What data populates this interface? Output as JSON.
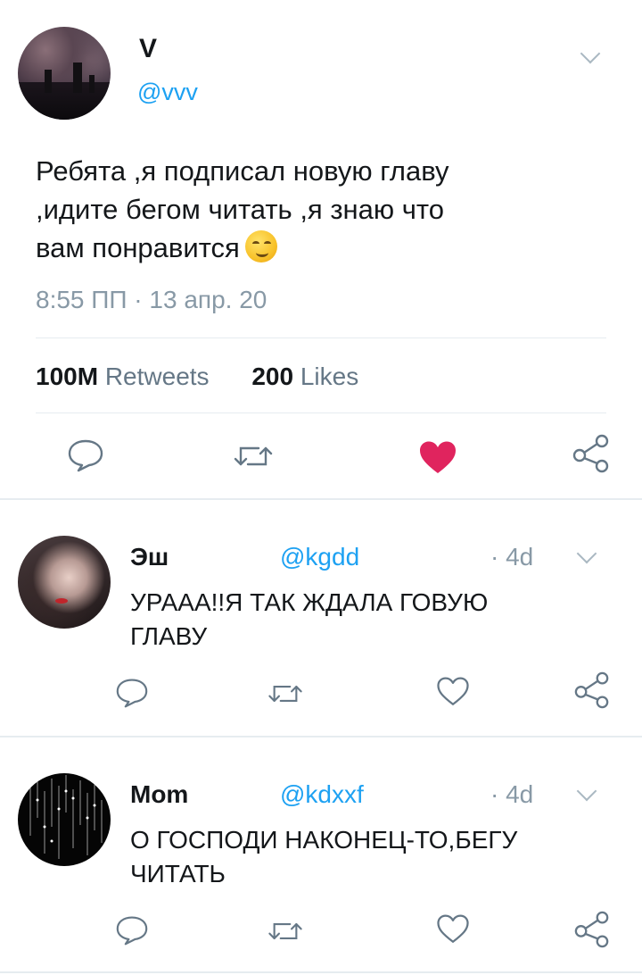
{
  "tweet": {
    "name": "V",
    "handle": "@vvv",
    "text": "Ребята ,я подписал новую главу ,идите бегом читать ,я знаю что вам понравится",
    "emoji": "smirking-face",
    "time": "8:55 ПП · 13 апр. 20",
    "retweets_count": "100M",
    "retweets_label": "Retweets",
    "likes_count": "200",
    "likes_label": "Likes",
    "liked": true,
    "like_color": "#e0245e"
  },
  "replies": [
    {
      "name": "Эш",
      "handle": "@kgdd",
      "time": "· 4d",
      "text": "УРААА!!Я ТАК ЖДАЛА ГОВУЮ ГЛАВУ"
    },
    {
      "name": "Mom",
      "handle": "@kdxxf",
      "time": "· 4d",
      "text": "О ГОСПОДИ НАКОНЕЦ-ТО,БЕГУ ЧИТАТЬ"
    }
  ],
  "colors": {
    "link": "#1da1f2",
    "muted": "#8899a6",
    "icon": "#657786"
  }
}
